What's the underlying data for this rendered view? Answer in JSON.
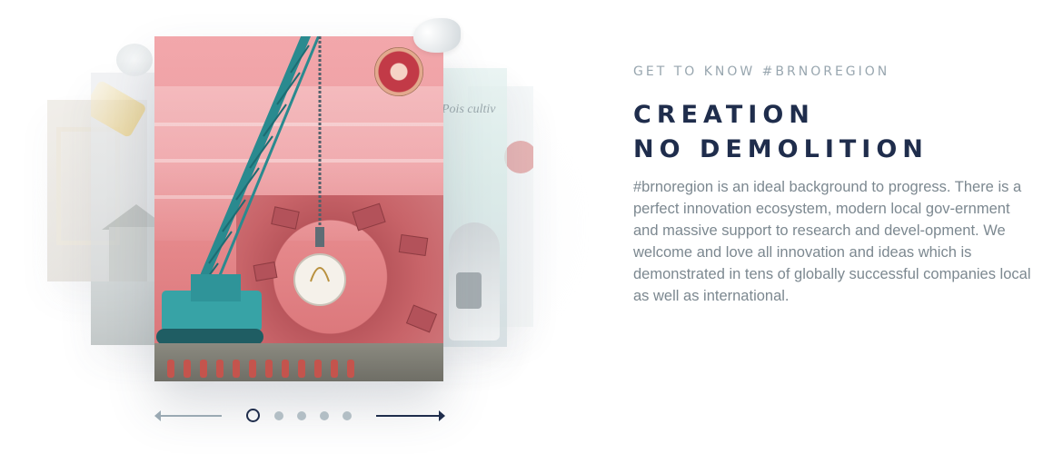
{
  "section": {
    "eyebrow": "GET TO KNOW #BRNOREGION",
    "headline_line1": "CREATION",
    "headline_line2": "NO DEMOLITION",
    "description": "#brnoregion is an ideal background to progress. There is a perfect innovation ecosystem, modern local gov-ernment and massive support to research and devel-opment. We welcome and love all innovation and ideas which is demonstrated in tens of globally successful companies local as well as international."
  },
  "carousel": {
    "slides_count": 5,
    "active_slide": 1,
    "side_card_text": "Pois cultiv",
    "prev_icon": "arrow-left-icon",
    "next_icon": "arrow-right-icon"
  },
  "colors": {
    "navy": "#1f2d4c",
    "muted_text": "#7c8890",
    "eyebrow": "#98a6af",
    "dot_inactive": "#b2bec5",
    "card_pink": "#ee9ea2",
    "crane_teal": "#2a8a8f"
  }
}
